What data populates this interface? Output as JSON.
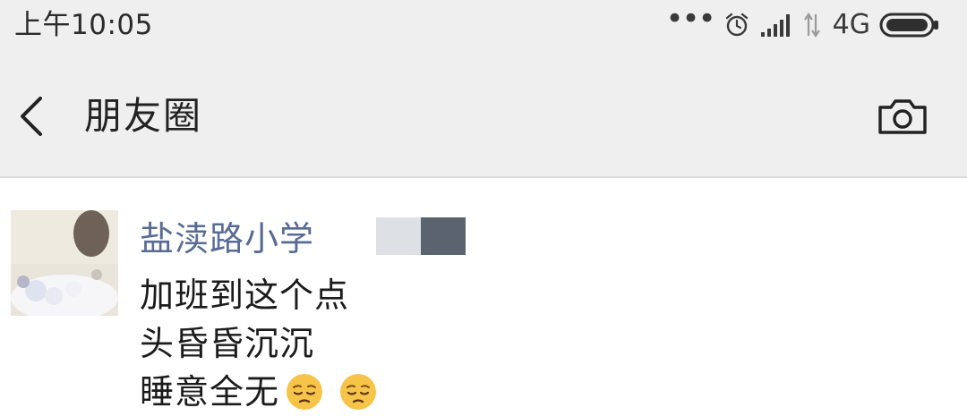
{
  "status_bar": {
    "time": "上午10:05",
    "dots": "•••",
    "network": "4G",
    "icons": [
      "more-dots-icon",
      "alarm-icon",
      "signal-icon",
      "data-arrows-icon",
      "battery-icon"
    ]
  },
  "header": {
    "title": "朋友圈",
    "back_icon": "chevron-left-icon",
    "camera_icon": "camera-icon"
  },
  "post": {
    "author": "盐渎路小学",
    "avatar_icon": "avatar-photo",
    "lines": [
      "加班到这个点",
      "头昏昏沉沉",
      "睡意全无"
    ],
    "emojis": [
      "pensive-face-emoji",
      "pensive-face-emoji"
    ]
  },
  "colors": {
    "bar_background": "#efefef",
    "author_link": "#576b95",
    "text": "#1b1b1b",
    "emoji_yellow": "#f7c44a"
  }
}
